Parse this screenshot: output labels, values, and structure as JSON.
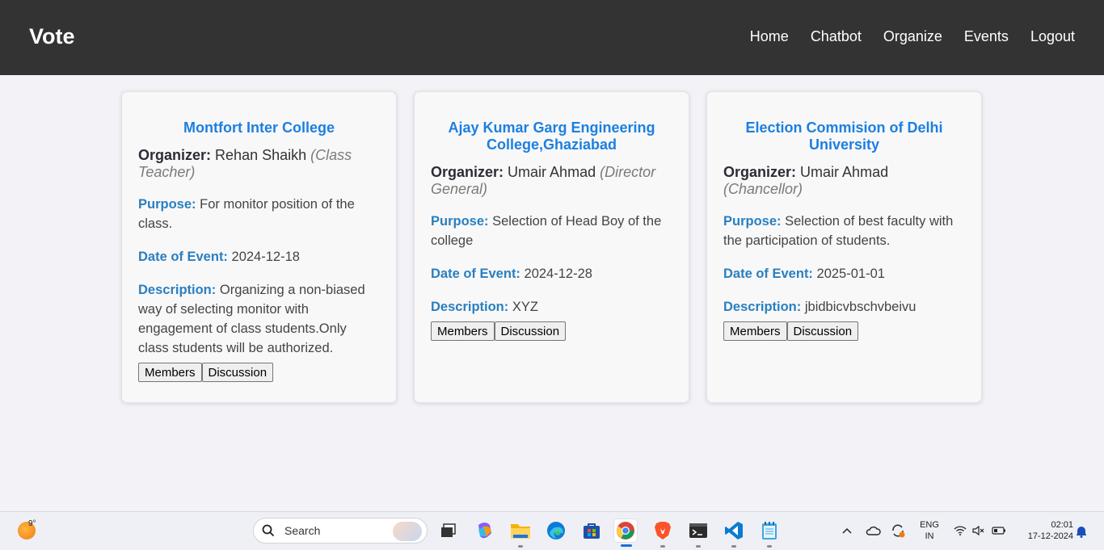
{
  "nav": {
    "brand": "Vote",
    "links": [
      "Home",
      "Chatbot",
      "Organize",
      "Events",
      "Logout"
    ]
  },
  "cards": [
    {
      "title": "Montfort Inter College",
      "organizer_label": "Organizer:",
      "organizer": "Rehan Shaikh",
      "role": "(Class Teacher)",
      "purpose_label": "Purpose:",
      "purpose": "For monitor position of the class.",
      "date_label": "Date of Event:",
      "date": "2024-12-18",
      "description_label": "Description:",
      "description": "Organizing a non-biased way of selecting monitor with engagement of class students.Only class students will be authorized.",
      "members_label": "Members",
      "discussion_label": "Discussion"
    },
    {
      "title": "Ajay Kumar Garg Engineering College,Ghaziabad",
      "organizer_label": "Organizer:",
      "organizer": "Umair Ahmad",
      "role": "(Director General)",
      "purpose_label": "Purpose:",
      "purpose": "Selection of Head Boy of the college",
      "date_label": "Date of Event:",
      "date": "2024-12-28",
      "description_label": "Description:",
      "description": "XYZ",
      "members_label": "Members",
      "discussion_label": "Discussion"
    },
    {
      "title": "Election Commision of Delhi University",
      "organizer_label": "Organizer:",
      "organizer": "Umair Ahmad",
      "role": "(Chancellor)",
      "purpose_label": "Purpose:",
      "purpose": "Selection of best faculty with the participation of students.",
      "date_label": "Date of Event:",
      "date": "2025-01-01",
      "description_label": "Description:",
      "description": "jbidbicvbschvbeivu",
      "members_label": "Members",
      "discussion_label": "Discussion"
    }
  ],
  "taskbar": {
    "temperature": "9°",
    "search_placeholder": "Search",
    "language": "ENG",
    "region": "IN",
    "time": "02:01",
    "date": "17-12-2024"
  },
  "colors": {
    "nav_bg": "#333333",
    "card_title": "#1c7fe0",
    "field_label": "#2a7fbf",
    "page_bg": "#f3f3f7"
  }
}
